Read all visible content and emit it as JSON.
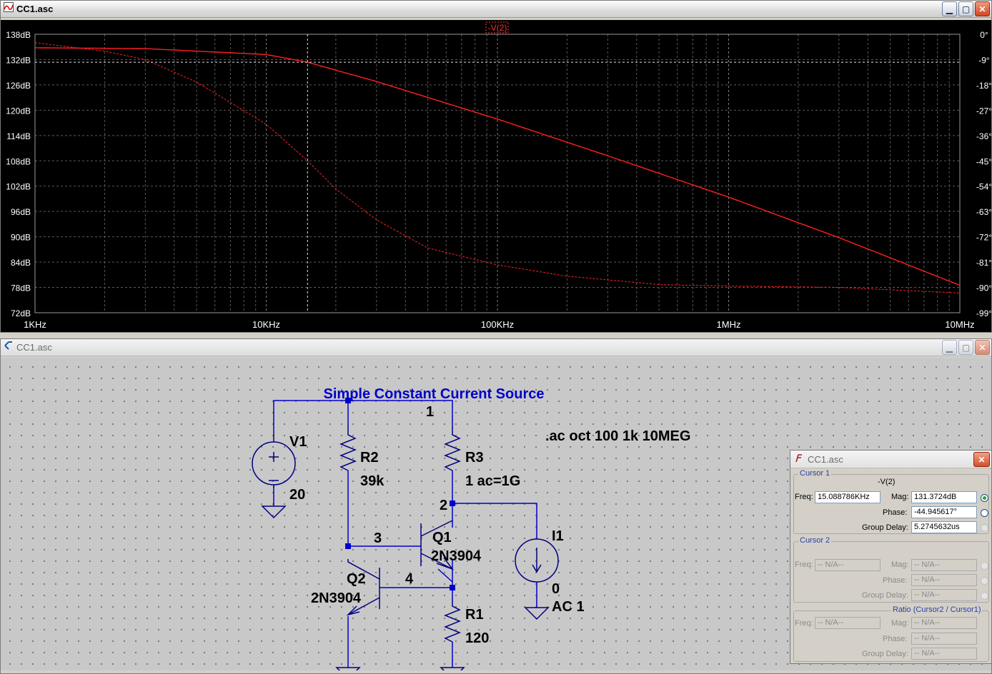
{
  "plot_window": {
    "title": "CC1.asc",
    "trace_label": "-V(2)",
    "left_axis": [
      "138dB",
      "132dB",
      "126dB",
      "120dB",
      "114dB",
      "108dB",
      "102dB",
      "96dB",
      "90dB",
      "84dB",
      "78dB",
      "72dB"
    ],
    "right_axis": [
      "0°",
      "-9°",
      "-18°",
      "-27°",
      "-36°",
      "-45°",
      "-54°",
      "-63°",
      "-72°",
      "-81°",
      "-90°",
      "-99°"
    ],
    "x_axis": [
      "1KHz",
      "10KHz",
      "100KHz",
      "1MHz",
      "10MHz"
    ],
    "trace_color": "#ff2020"
  },
  "chart_data": {
    "type": "line",
    "title": "-V(2)",
    "x_scale": "log",
    "xlim": [
      1000,
      10000000
    ],
    "ylim_left": [
      72,
      138
    ],
    "ylim_right": [
      -99,
      0
    ],
    "series": [
      {
        "name": "-V(2)",
        "axis": "magnitude_dB",
        "x": [
          1000,
          3000,
          10000,
          15088.786,
          30000,
          100000,
          300000,
          1000000,
          3000000,
          10000000
        ],
        "y": [
          134.8,
          134.6,
          133.2,
          131.37,
          126.8,
          117.9,
          109.2,
          99.4,
          89.8,
          78.5
        ]
      },
      {
        "name": "-V(2) phase",
        "axis": "phase_deg",
        "style": "dashed",
        "x": [
          1000,
          2000,
          3000,
          5000,
          10000,
          15088.786,
          20000,
          30000,
          50000,
          100000,
          200000,
          500000,
          1000000,
          3000000,
          10000000
        ],
        "y": [
          -3,
          -6,
          -9,
          -17,
          -32,
          -45,
          -55,
          -66,
          -76,
          -82,
          -86,
          -89,
          -89.5,
          -90,
          -92
        ]
      }
    ],
    "cursor": {
      "freq": 15088.786,
      "mag": 131.3724
    }
  },
  "schematic_window": {
    "title": "CC1.asc",
    "heading": "Simple Constant Current Source",
    "directive": ".ac oct 100 1k 10MEG",
    "labels": {
      "node1": "1",
      "node2": "2",
      "node3": "3",
      "node4": "4",
      "v1_name": "V1",
      "v1_value": "20",
      "r2_name": "R2",
      "r2_value": "39k",
      "r3_name": "R3",
      "r3_value": "1 ac=1G",
      "q1_name": "Q1",
      "q1_model": "2N3904",
      "q2_name": "Q2",
      "q2_model": "2N3904",
      "r1_name": "R1",
      "r1_value": "120",
      "i1_name": "I1",
      "i1_value": "0",
      "i1_ac": "AC 1"
    },
    "wire_color": "#0000cc",
    "text_color": "#000000",
    "heading_color": "#0000cc"
  },
  "cursor_window": {
    "title": "CC1.asc",
    "cursor1": {
      "group_label": "Cursor 1",
      "trace": "-V(2)",
      "freq_label": "Freq:",
      "freq": "15.088786KHz",
      "mag_label": "Mag:",
      "mag": "131.3724dB",
      "phase_label": "Phase:",
      "phase": "-44.945617°",
      "gd_label": "Group Delay:",
      "gd": "5.2745632us"
    },
    "cursor2": {
      "group_label": "Cursor 2",
      "freq_label": "Freq:",
      "freq": "-- N/A--",
      "mag_label": "Mag:",
      "mag": "-- N/A--",
      "phase_label": "Phase:",
      "phase": "-- N/A--",
      "gd_label": "Group Delay:",
      "gd": "-- N/A--"
    },
    "ratio": {
      "group_label": "Ratio (Cursor2 / Cursor1)",
      "freq_label": "Freq:",
      "freq": "-- N/A--",
      "mag_label": "Mag:",
      "mag": "-- N/A--",
      "phase_label": "Phase:",
      "phase": "-- N/A--",
      "gd_label": "Group Delay:",
      "gd": "-- N/A--"
    }
  }
}
